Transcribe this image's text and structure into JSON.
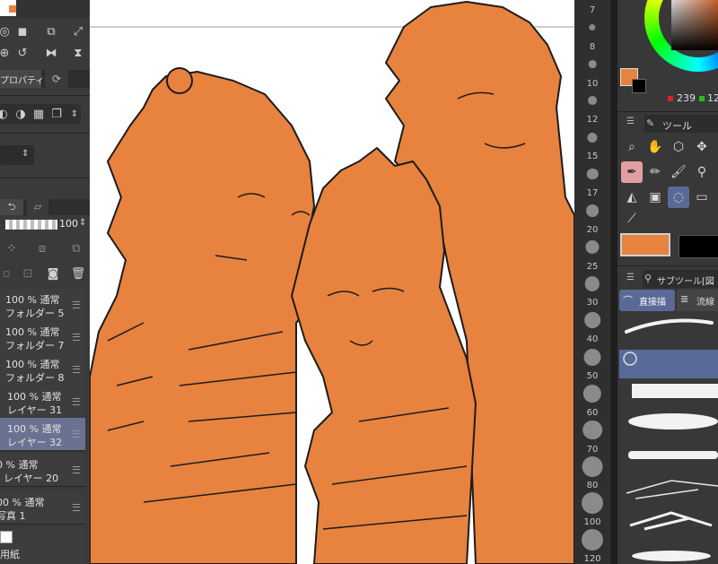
{
  "left_panel": {
    "property_tab": "プロパティ",
    "opacity_value": "100",
    "layers": [
      {
        "line1": "100 % 通常",
        "line2": "フォルダー 5",
        "selected": false
      },
      {
        "line1": "100 % 通常",
        "line2": "フォルダー 7",
        "selected": false
      },
      {
        "line1": "100 % 通常",
        "line2": "フォルダー 8",
        "selected": false
      },
      {
        "line1": "100 % 通常",
        "line2": "レイヤー 31",
        "selected": false
      },
      {
        "line1": "100 % 通常",
        "line2": "レイヤー 32",
        "selected": true
      },
      {
        "line1": "0 % 通常",
        "line2": "レイヤー 20",
        "selected": false
      },
      {
        "line1": "00 % 通常",
        "line2": "写真 1",
        "selected": false
      }
    ],
    "paper_label": "用紙"
  },
  "brush_sizes": [
    "7",
    "8",
    "10",
    "12",
    "15",
    "17",
    "20",
    "25",
    "30",
    "40",
    "50",
    "60",
    "70",
    "80",
    "100",
    "120"
  ],
  "color": {
    "main_hex": "#e8823f",
    "r_value": "239",
    "g_value": "12"
  },
  "tool_panel": {
    "title": "ツール"
  },
  "subtool_panel": {
    "title": "サブツール[図",
    "tab_active": "直接描",
    "tab_other": "流線"
  }
}
